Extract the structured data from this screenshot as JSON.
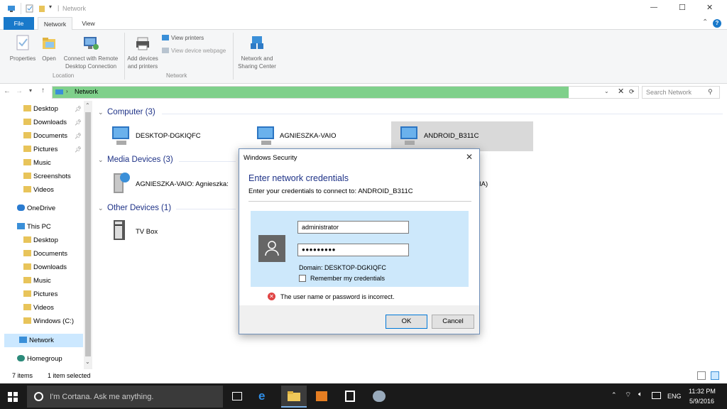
{
  "window": {
    "title": "Network",
    "minimize": "—",
    "maximize": "☐",
    "close": "✕",
    "help": "?",
    "collapse": "⌃"
  },
  "ribbon": {
    "tabs": [
      "File",
      "Network",
      "View"
    ],
    "properties": "Properties",
    "open": "Open",
    "connect_remote": [
      "Connect with Remote",
      "Desktop Connection"
    ],
    "add_devices": [
      "Add devices",
      "and printers"
    ],
    "view_printers": "View printers",
    "view_device_webpage": "View device webpage",
    "network_sharing": [
      "Network and",
      "Sharing Center"
    ],
    "group_location": "Location",
    "group_network": "Network"
  },
  "address": {
    "path": "Network",
    "search_placeholder": "Search Network"
  },
  "nav": {
    "quick": [
      {
        "label": "Desktop",
        "pinned": true
      },
      {
        "label": "Downloads",
        "pinned": true
      },
      {
        "label": "Documents",
        "pinned": true
      },
      {
        "label": "Pictures",
        "pinned": true
      },
      {
        "label": "Music",
        "pinned": false
      },
      {
        "label": "Screenshots",
        "pinned": false
      },
      {
        "label": "Videos",
        "pinned": false
      }
    ],
    "onedrive": "OneDrive",
    "thispc": "This PC",
    "pc_items": [
      "Desktop",
      "Documents",
      "Downloads",
      "Music",
      "Pictures",
      "Videos",
      "Windows (C:)"
    ],
    "network": "Network",
    "homegroup": "Homegroup"
  },
  "main": {
    "computer_header": "Computer (3)",
    "computers": [
      "DESKTOP-DGKIQFC",
      "AGNIESZKA-VAIO",
      "ANDROID_B311C"
    ],
    "media_header": "Media Devices (3)",
    "media": [
      "AGNIESZKA-VAIO: Agnieszka:",
      "IA)"
    ],
    "other_header": "Other Devices (1)",
    "other": [
      "TV Box"
    ]
  },
  "status": {
    "items": "7 items",
    "selected": "1 item selected"
  },
  "dialog": {
    "title": "Windows Security",
    "heading": "Enter network credentials",
    "subtitle": "Enter your credentials to connect to: ANDROID_B311C",
    "username": "administrator",
    "password": "●●●●●●●●●",
    "domain": "Domain: DESKTOP-DGKIQFC",
    "remember": "Remember my credentials",
    "error": "The user name or password is incorrect.",
    "ok": "OK",
    "cancel": "Cancel"
  },
  "taskbar": {
    "cortana": "I'm Cortana. Ask me anything.",
    "lang": "ENG",
    "time": "11:32 PM",
    "date": "5/9/2016"
  },
  "colors": {
    "accent": "#1979ca",
    "address_bar": "#7fd08b",
    "selection": "#cce8ff",
    "dialog_panel": "#cde8fb",
    "error": "#e04343"
  }
}
